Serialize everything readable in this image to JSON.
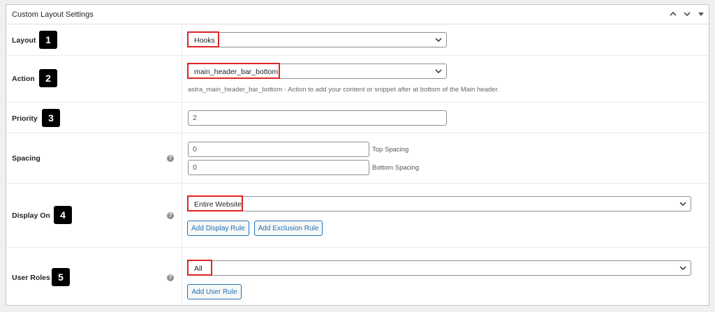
{
  "panel": {
    "title": "Custom Layout Settings",
    "controls": {
      "up": "up-arrow",
      "down": "down-arrow",
      "toggle": "toggle-arrow"
    }
  },
  "rows": {
    "layout": {
      "label": "Layout",
      "badge": "1",
      "value": "Hooks"
    },
    "action": {
      "label": "Action",
      "badge": "2",
      "value": "main_header_bar_bottom",
      "description": "astra_main_header_bar_bottom - Action to add your content or snippet after at bottom of the Main header."
    },
    "priority": {
      "label": "Priority",
      "badge": "3",
      "value": "2"
    },
    "spacing": {
      "label": "Spacing",
      "top_value": "0",
      "top_label": "Top Spacing",
      "bottom_value": "0",
      "bottom_label": "Bottom Spacing"
    },
    "display_on": {
      "label": "Display On",
      "badge": "4",
      "value": "Entire Website",
      "add_display_rule": "Add Display Rule",
      "add_exclusion_rule": "Add Exclusion Rule"
    },
    "user_roles": {
      "label": "User Roles",
      "badge": "5",
      "value": "All",
      "add_user_rule": "Add User Rule"
    }
  },
  "colors": {
    "highlight": "#e02424",
    "button": "#2271b1",
    "badge": "#000000"
  }
}
